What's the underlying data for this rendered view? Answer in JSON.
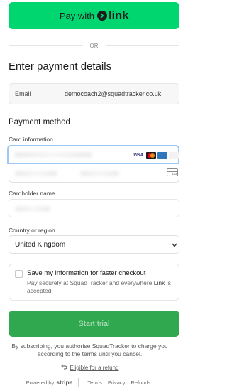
{
  "link_button": {
    "pay_label": "Pay with",
    "brand": "link"
  },
  "divider": {
    "label": "OR"
  },
  "heading": "Enter payment details",
  "email": {
    "label": "Email",
    "value": "democoach2@squadtracker.co.uk"
  },
  "payment_method": {
    "heading": "Payment method",
    "card_label": "Card information",
    "brands": [
      "VISA",
      "mastercard",
      "AMEX",
      "discover"
    ],
    "cvc_hint": "123"
  },
  "cardholder": {
    "label": "Cardholder name"
  },
  "country": {
    "label": "Country or region",
    "value": "United Kingdom"
  },
  "save_info": {
    "title": "Save my information for faster checkout",
    "desc_prefix": "Pay securely at SquadTracker and everywhere ",
    "desc_link": "Link",
    "desc_suffix": " is accepted."
  },
  "submit": {
    "label": "Start trial"
  },
  "terms": "By subscribing, you authorise SquadTracker to charge you according to the terms until you cancel.",
  "refund": {
    "icon": "return-arrow-icon",
    "label": "Eligible for a refund"
  },
  "footer": {
    "powered_by": "Powered by",
    "stripe": "stripe",
    "terms": "Terms",
    "privacy": "Privacy",
    "refunds": "Refunds"
  },
  "colors": {
    "link_green": "#00d66f",
    "submit_green": "#2fa84f",
    "focus_blue": "#9cc9f5"
  }
}
